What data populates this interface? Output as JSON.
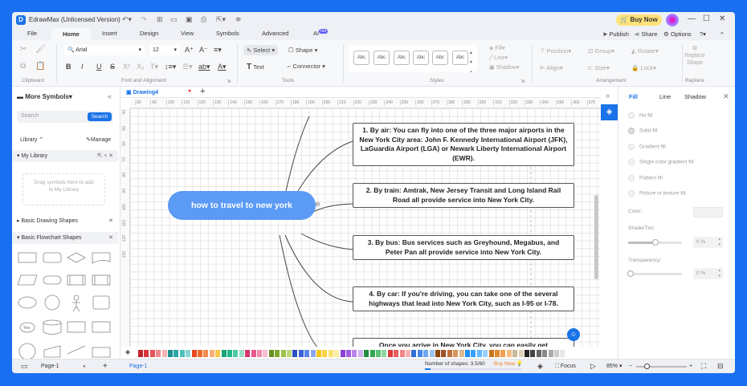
{
  "app": {
    "title": "EdrawMax (Unlicensed Version)",
    "buy_now": "Buy Now"
  },
  "menu_tabs": [
    "File",
    "Home",
    "Insert",
    "Design",
    "View",
    "Symbols",
    "Advanced",
    "AI"
  ],
  "ai_badge": "hot",
  "right_tools": {
    "publish": "Publish",
    "share": "Share",
    "options": "Options"
  },
  "ribbon": {
    "font": "Arial",
    "size": "12",
    "select": "Select",
    "shape": "Shape",
    "text": "Text",
    "connector": "Connector",
    "style_sample": "Abc",
    "fill": "Fill",
    "line": "Line",
    "shadow": "Shadow",
    "position": "Position",
    "group": "Group",
    "rotate": "Rotate",
    "align": "Align",
    "size_btn": "Size",
    "lock": "Lock",
    "replace_shape": "Replace Shape",
    "groups": {
      "clipboard": "Clipboard",
      "font": "Font and Alignment",
      "tools": "Tools",
      "styles": "Styles",
      "arrangement": "Arrangement",
      "replace": "Replace"
    }
  },
  "left_panel": {
    "title": "More Symbols",
    "search_placeholder": "Search",
    "search_btn": "Search",
    "library": "Library",
    "manage": "Manage",
    "my_library": "My Library",
    "drop_hint": "Drag symbols here to add to My Library",
    "basic_drawing": "Basic Drawing Shapes",
    "basic_flowchart": "Basic Flowchart Shapes",
    "yes_label": "Yes"
  },
  "document": {
    "tab": "Drawing4"
  },
  "rulers": {
    "h": [
      "80",
      "90",
      "100",
      "110",
      "120",
      "130",
      "140",
      "150",
      "160",
      "170",
      "180",
      "190",
      "200",
      "210",
      "220",
      "230",
      "240",
      "250",
      "260",
      "270",
      "280",
      "290",
      "300",
      "310",
      "320",
      "330",
      "340",
      "350",
      "360",
      "370"
    ],
    "v": [
      "40",
      "50",
      "60",
      "70",
      "80",
      "90",
      "100",
      "110",
      "120",
      "130"
    ]
  },
  "mindmap": {
    "central": "how to travel to new york",
    "topics": [
      "1. By air: You can fly into one of the three major airports in the New York City area: John F. Kennedy International Airport (JFK), LaGuardia Airport (LGA) or Newark Liberty International Airport (EWR).",
      "2. By train: Amtrak, New Jersey Transit and Long Island Rail Road all provide service into New York City.",
      "3. By bus: Bus services such as Greyhound, Megabus, and Peter Pan all provide service into New York City.",
      "4. By car: If you're driving, you can take one of the several highways that lead into New York City, such as I-95 or I-78.",
      "Once you arrive in New York City, you can easily get"
    ]
  },
  "right_panel": {
    "tabs": [
      "Fill",
      "Line",
      "Shadow"
    ],
    "options": [
      "No fill",
      "Solid fill",
      "Gradient fill",
      "Single color gradient fill",
      "Pattern fill",
      "Picture or texture fill"
    ],
    "color_label": "Color:",
    "shade_label": "Shade/Tint:",
    "shade_value": "0 %",
    "shade_level": 0.5,
    "transparency_label": "Transparency:",
    "transparency_value": "0 %"
  },
  "status": {
    "page_selector": "Page-1",
    "page_tab": "Page-1",
    "shapes": "Number of shapes: 3.5/60",
    "buy_now": "Buy Now",
    "focus": "Focus",
    "zoom": "85%"
  },
  "palette": [
    "#c0262b",
    "#d9363e",
    "#e8545a",
    "#f08a8e",
    "#f4b3b5",
    "#1f8f8f",
    "#2aa6a6",
    "#4fc0c0",
    "#8ad6d6",
    "#e8481c",
    "#f26a2e",
    "#f58c4f",
    "#f9ae7c",
    "#f8c84a",
    "#1aa37a",
    "#24b58a",
    "#4fc9a3",
    "#9addc5",
    "#d6356e",
    "#e8588c",
    "#f28bb0",
    "#f7bcd1",
    "#6b8e23",
    "#7fa832",
    "#9cc24b",
    "#bcd67c",
    "#2a4fc0",
    "#3a62d6",
    "#5b82e8",
    "#8ea8f0",
    "#f5c518",
    "#f8d341",
    "#fae06e",
    "#fcec9e",
    "#8a3fd0",
    "#a05ce0",
    "#b886ea",
    "#d2b0f3",
    "#248a3d",
    "#33a650",
    "#5bbf74",
    "#8fd5a0",
    "#e03b3b",
    "#ec5e5e",
    "#f38888",
    "#f7b1b1",
    "#2f6fd6",
    "#4689ea",
    "#6ea6f2",
    "#9cc3f7",
    "#8b4513",
    "#a0522d",
    "#c2703d",
    "#d9955f",
    "#ddb98f",
    "#1e90ff",
    "#3aa0ff",
    "#66b8ff",
    "#99d0ff",
    "#c8761e",
    "#e08a2e",
    "#f0a050",
    "#f5bb80",
    "#c8b89a",
    "#e0d3bd",
    "#222222",
    "#444444",
    "#666666",
    "#888888",
    "#aaaaaa",
    "#cccccc",
    "#e6e6e6"
  ]
}
